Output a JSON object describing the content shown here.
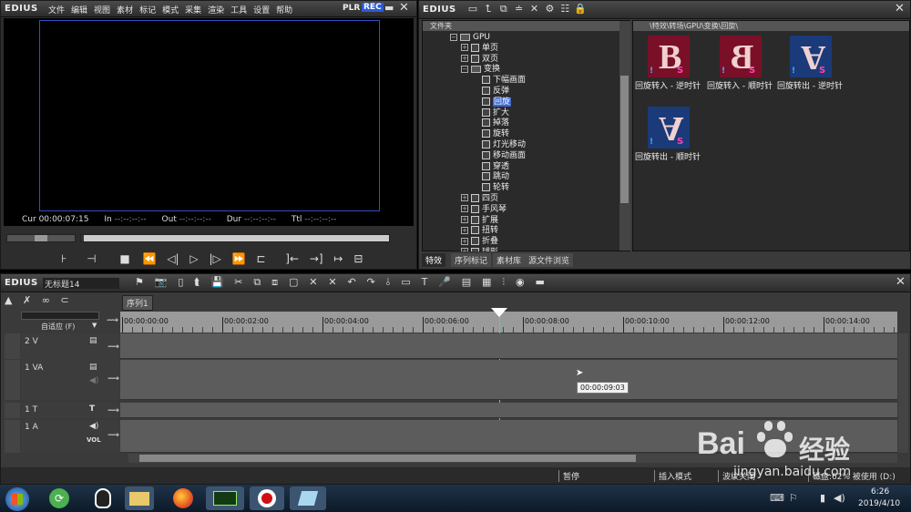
{
  "player": {
    "logo": "EDIUS",
    "menu": [
      "文件",
      "编辑",
      "视图",
      "素材",
      "标记",
      "模式",
      "采集",
      "渲染",
      "工具",
      "设置",
      "帮助"
    ],
    "plr": "PLR",
    "rec": "REC",
    "timecodes": {
      "cur_label": "Cur",
      "cur": "00:00:07:15",
      "in_label": "In",
      "in": "--:--:--:--",
      "out_label": "Out",
      "out": "--:--:--:--",
      "dur_label": "Dur",
      "dur": "--:--:--:--",
      "ttl_label": "Ttl",
      "ttl": "--:--:--:--"
    }
  },
  "effects": {
    "logo": "EDIUS",
    "folder_header": "文件夹",
    "path": "\\特效\\转场\\GPU\\变换\\回旋\\",
    "tree": [
      {
        "label": "GPU",
        "level": 0,
        "type": "folder-open"
      },
      {
        "label": "单页",
        "level": 1,
        "type": "closed"
      },
      {
        "label": "双页",
        "level": 1,
        "type": "closed"
      },
      {
        "label": "变换",
        "level": 1,
        "type": "open"
      },
      {
        "label": "下幅画面",
        "level": 2,
        "type": "leaf"
      },
      {
        "label": "反弹",
        "level": 2,
        "type": "leaf"
      },
      {
        "label": "回旋",
        "level": 2,
        "type": "leaf",
        "selected": true
      },
      {
        "label": "扩大",
        "level": 2,
        "type": "leaf"
      },
      {
        "label": "掉落",
        "level": 2,
        "type": "leaf"
      },
      {
        "label": "旋转",
        "level": 2,
        "type": "leaf"
      },
      {
        "label": "灯光移动",
        "level": 2,
        "type": "leaf"
      },
      {
        "label": "移动画面",
        "level": 2,
        "type": "leaf"
      },
      {
        "label": "穿透",
        "level": 2,
        "type": "leaf"
      },
      {
        "label": "跳动",
        "level": 2,
        "type": "leaf"
      },
      {
        "label": "轮转",
        "level": 2,
        "type": "leaf"
      },
      {
        "label": "四页",
        "level": 1,
        "type": "closed"
      },
      {
        "label": "手风琴",
        "level": 1,
        "type": "closed"
      },
      {
        "label": "扩展",
        "level": 1,
        "type": "closed"
      },
      {
        "label": "扭转",
        "level": 1,
        "type": "closed"
      },
      {
        "label": "折叠",
        "level": 1,
        "type": "closed"
      },
      {
        "label": "球形",
        "level": 1,
        "type": "closed"
      }
    ],
    "items": [
      {
        "caption": "回旋转入 - 逆时针",
        "letter": "B",
        "bg": "#7a1028"
      },
      {
        "caption": "回旋转入 - 顺时针",
        "letter": "B",
        "bg": "#7a1028"
      },
      {
        "caption": "回旋转出 - 逆时针",
        "letter": "A",
        "bg": "#1a3a7a"
      },
      {
        "caption": "回旋转出 - 顺时针",
        "letter": "A",
        "bg": "#1a3a7a"
      }
    ],
    "tabs": [
      "特效",
      "序列标记",
      "素材库",
      "源文件浏览"
    ]
  },
  "timeline": {
    "logo": "EDIUS",
    "project": "无标题14",
    "sequence_tab": "序列1",
    "mode_label": "自适应 (F)",
    "ruler": [
      "00:00:00:00",
      "00:00:02:00",
      "00:00:04:00",
      "00:00:06:00",
      "00:00:08:00",
      "00:00:10:00",
      "00:00:12:00",
      "00:00:14:00"
    ],
    "tracks": [
      {
        "name": "2 V"
      },
      {
        "name": "1 VA"
      },
      {
        "name": "1 T"
      },
      {
        "name": "1 A",
        "vol": "VOL"
      }
    ],
    "tooltip": "00:00:09:03",
    "playhead_fraction": 0.488
  },
  "status": {
    "pause": "暂停",
    "insert_mode": "插入模式",
    "ripple": "波纹关闭",
    "disk": "磁盘:62% 被使用 (D:)"
  },
  "taskbar": {
    "time": "6:26",
    "date": "2019/4/10"
  },
  "watermark": {
    "brand": "Bai",
    "brand2": "经验",
    "url": "jingyan.baidu.com"
  },
  "colors": {
    "accent": "#2a5bd7",
    "selection": "#3a66d0",
    "playhead": "#2ee0b0"
  }
}
